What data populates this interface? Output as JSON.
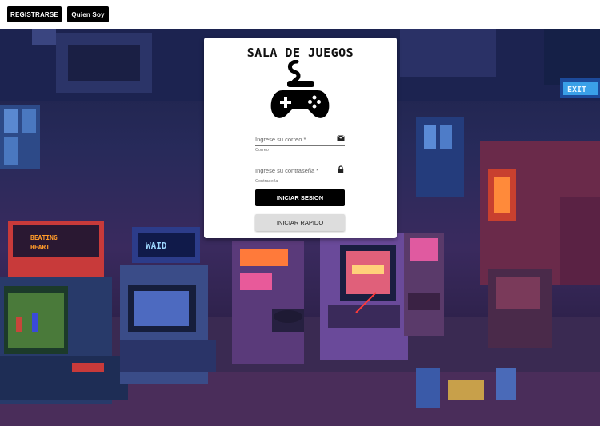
{
  "nav": {
    "register_label": "REGISTRARSE",
    "about_label": "Quien Soy"
  },
  "login": {
    "title": "SALA DE JUEGOS",
    "logo_icon": "gamepad-icon",
    "email": {
      "placeholder": "Ingrese su correo *",
      "hint": "Correo",
      "icon": "mail-icon"
    },
    "password": {
      "placeholder": "Ingrese su contraseña *",
      "hint": "Contraseña",
      "icon": "lock-icon"
    },
    "login_label": "INICIAR SESION",
    "quick_label": "INICIAR RAPIDO"
  },
  "background": {
    "scene": "pixel-art arcade room",
    "signs": [
      "BEATING HEART",
      "WAID",
      "EXIT"
    ]
  }
}
